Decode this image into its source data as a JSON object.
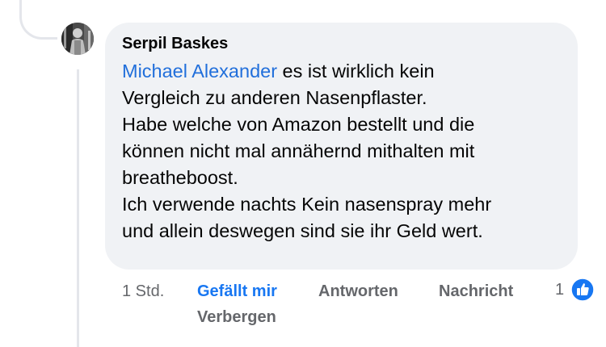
{
  "comment": {
    "author": "Serpil Baskes",
    "mention": "Michael Alexander",
    "lines": [
      " es ist wirklich kein",
      "Vergleich zu anderen Nasenpflaster.",
      "Habe welche von Amazon bestellt und die",
      "können nicht mal annähernd mithalten mit",
      "breatheboost.",
      "Ich verwende nachts Kein nasenspray mehr",
      "und allein deswegen sind sie ihr Geld wert."
    ],
    "reaction_count": "1",
    "reaction_icon": "like-thumbs-up-icon"
  },
  "actions": {
    "time": "1 Std.",
    "like": "Gefällt mir",
    "reply": "Antworten",
    "message": "Nachricht",
    "hide": "Verbergen"
  },
  "colors": {
    "bubble_bg": "#f0f2f5",
    "mention": "#216fdb",
    "like_active": "#1877f2",
    "action_gray": "#65676b",
    "thread_line": "#e4e6eb"
  }
}
